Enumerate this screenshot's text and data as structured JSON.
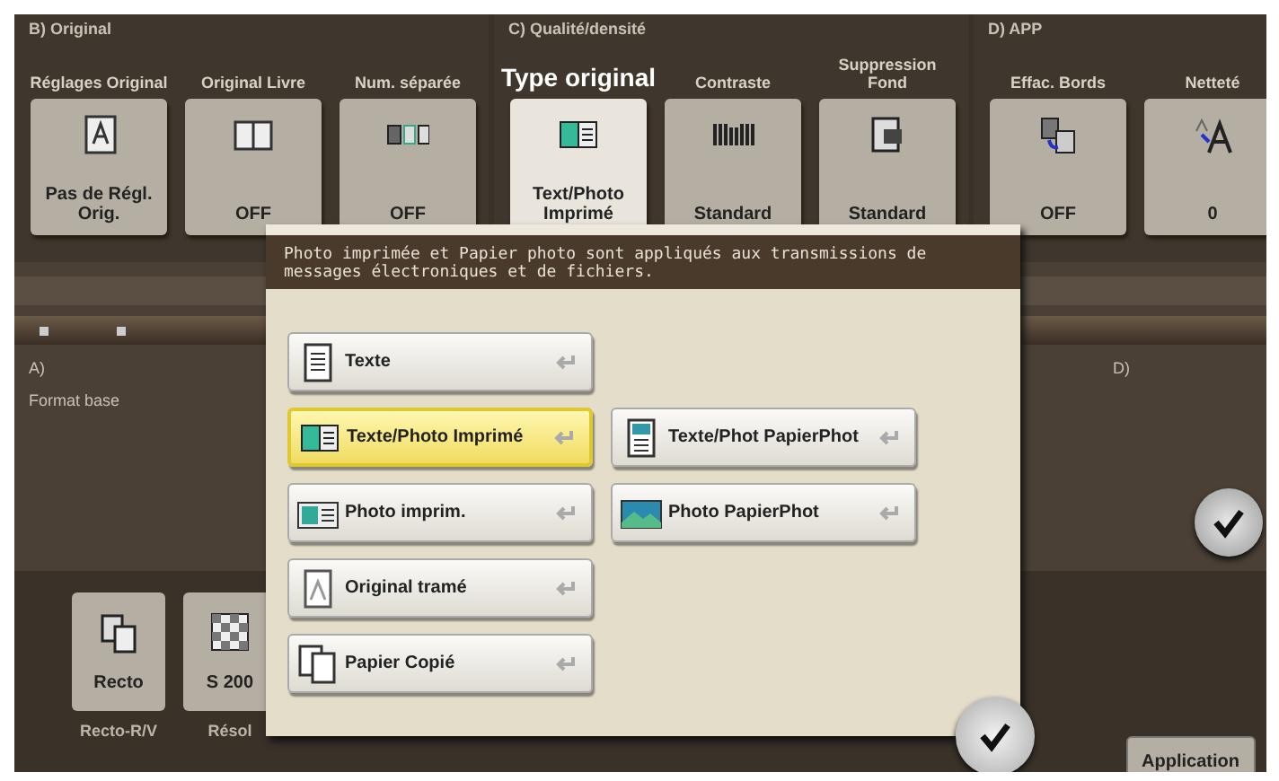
{
  "groups": [
    {
      "title": "B) Original",
      "tiles": [
        {
          "label": "Réglages Original",
          "value": "Pas de Régl. Orig.",
          "kind": "letter",
          "selected": false
        },
        {
          "label": "Original Livre",
          "value": "OFF",
          "kind": "book",
          "selected": false
        },
        {
          "label": "Num. séparée",
          "value": "OFF",
          "kind": "pages",
          "selected": false
        }
      ]
    },
    {
      "title": "C) Qualité/densité",
      "tiles": [
        {
          "label": "Type original",
          "value": "Text/Photo Imprimé",
          "kind": "textphoto",
          "selected": true
        },
        {
          "label": "Contraste",
          "value": "Standard",
          "kind": "bars",
          "selected": false
        },
        {
          "label": "Suppression Fond",
          "value": "Standard",
          "kind": "bgremove",
          "selected": false
        }
      ]
    },
    {
      "title": "D) APP",
      "tiles": [
        {
          "label": "Effac. Bords",
          "value": "OFF",
          "kind": "edge",
          "selected": false
        },
        {
          "label": "Netteté",
          "value": "0",
          "kind": "sharp",
          "selected": false
        }
      ]
    }
  ],
  "section_a": {
    "title": "A)",
    "item": "Format base"
  },
  "section_d": {
    "title": "D)"
  },
  "bottom_tiles": [
    {
      "value": "Recto",
      "label": "Recto-R/V",
      "kind": "duplex"
    },
    {
      "value": "S 200",
      "label": "Résol",
      "kind": "checker"
    }
  ],
  "application_button": "Application",
  "popup": {
    "message": "Photo imprimée et Papier photo sont appliqués aux transmissions de messages électroniques et de fichiers.",
    "left_options": [
      {
        "label": "Texte",
        "kind": "text",
        "selected": false
      },
      {
        "label": "Texte/Photo Imprimé",
        "kind": "textphoto",
        "selected": true
      },
      {
        "label": "Photo imprim.",
        "kind": "photo",
        "selected": false
      },
      {
        "label": "Original tramé",
        "kind": "screened",
        "selected": false
      },
      {
        "label": "Papier Copié",
        "kind": "copy",
        "selected": false
      }
    ],
    "right_options": [
      {
        "label": "Texte/Phot PapierPhot",
        "kind": "textpaper",
        "selected": false
      },
      {
        "label": "Photo PapierPhot",
        "kind": "photopaper",
        "selected": false
      }
    ]
  }
}
